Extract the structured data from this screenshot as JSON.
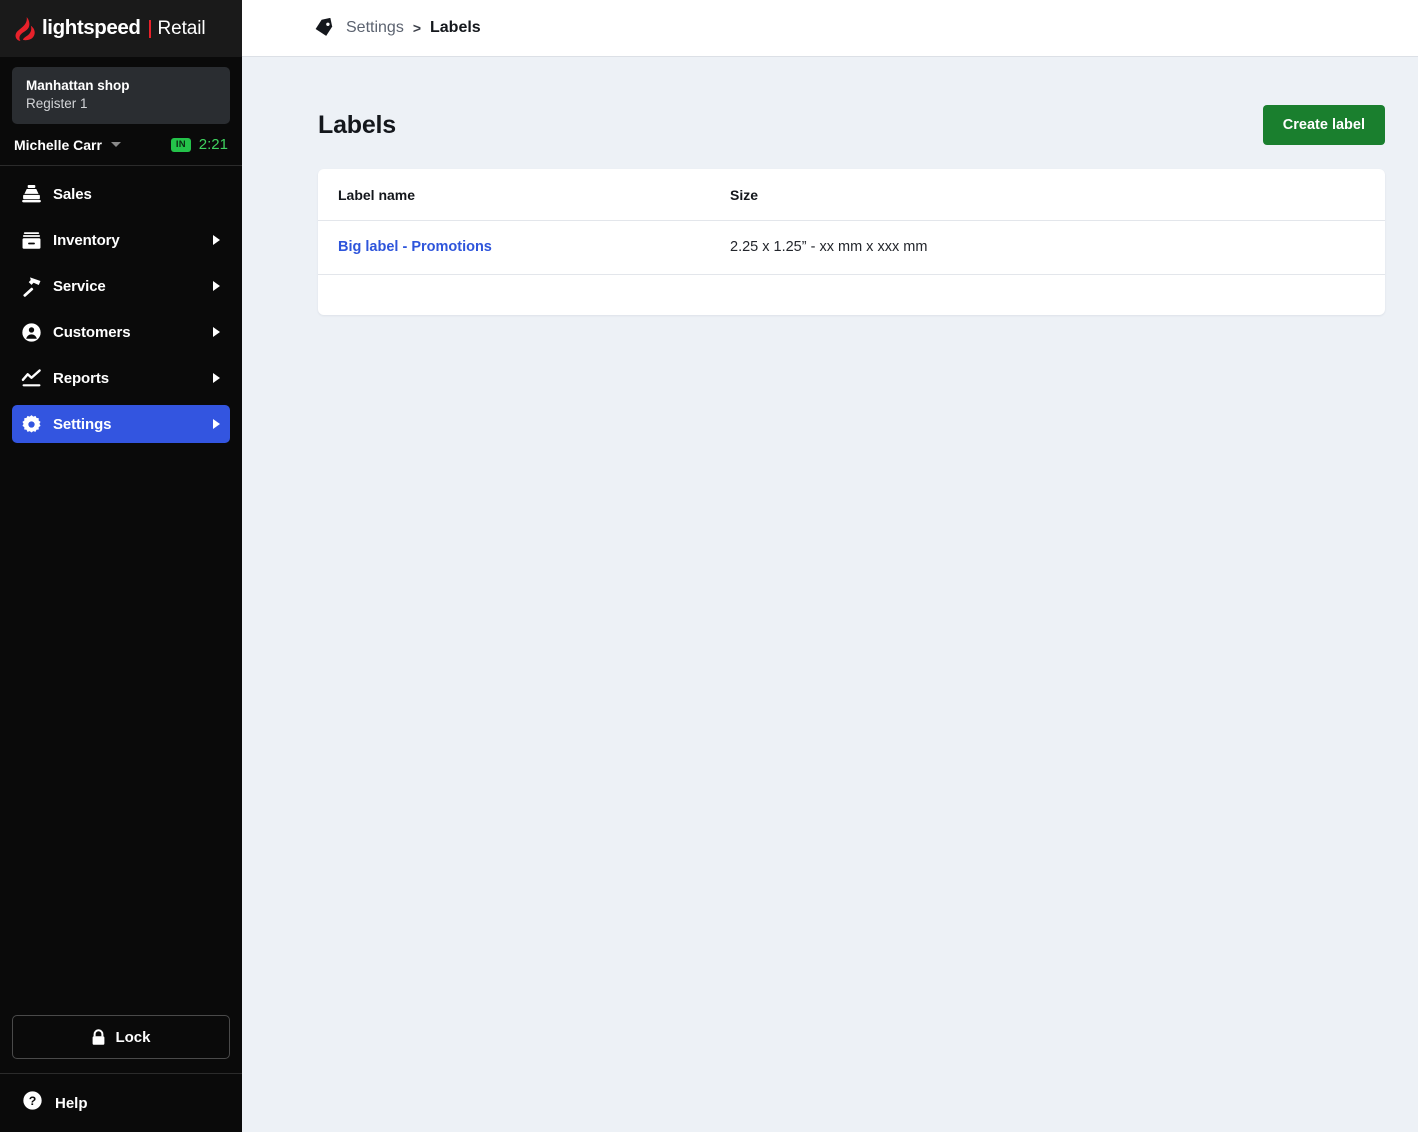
{
  "brand": {
    "name": "lightspeed",
    "product": "Retail",
    "flame_icon": "flame-icon",
    "accent_red": "#E8212A"
  },
  "sidebar": {
    "store": {
      "name": "Manhattan shop",
      "register": "Register 1"
    },
    "user": {
      "name": "Michelle Carr",
      "dropdown_icon": "chevron-down-icon",
      "status_badge": "IN",
      "status_color": "#24C24A",
      "timer": "2:21",
      "timer_color": "#3FD35F"
    },
    "items": [
      {
        "label": "Sales",
        "icon": "cash-register-icon",
        "has_submenu": false,
        "active": false
      },
      {
        "label": "Inventory",
        "icon": "box-icon",
        "has_submenu": true,
        "active": false
      },
      {
        "label": "Service",
        "icon": "hammer-icon",
        "has_submenu": true,
        "active": false
      },
      {
        "label": "Customers",
        "icon": "user-circle-icon",
        "has_submenu": true,
        "active": false
      },
      {
        "label": "Reports",
        "icon": "line-chart-icon",
        "has_submenu": true,
        "active": false
      },
      {
        "label": "Settings",
        "icon": "gear-icon",
        "has_submenu": true,
        "active": true
      }
    ],
    "active_color": "#3355E0",
    "lock_button": {
      "label": "Lock",
      "icon": "lock-icon"
    },
    "help": {
      "label": "Help",
      "icon": "question-circle-icon"
    }
  },
  "breadcrumb": {
    "icon": "tag-icon",
    "parent": "Settings",
    "separator": ">",
    "current": "Labels"
  },
  "main": {
    "title": "Labels",
    "create_button": {
      "label": "Create label",
      "color": "#1A7F2E"
    },
    "table": {
      "columns": [
        "Label name",
        "Size"
      ],
      "rows": [
        {
          "name": "Big label - Promotions",
          "size": "2.25 x 1.25” - xx mm x xxx mm"
        }
      ],
      "link_color": "#2E55DB"
    }
  }
}
